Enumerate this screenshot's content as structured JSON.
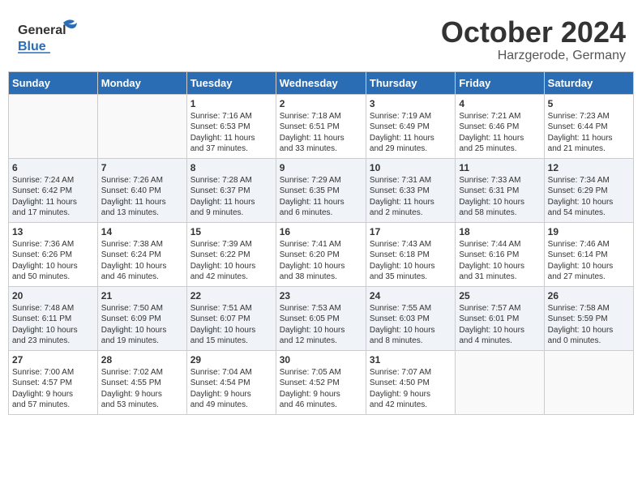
{
  "header": {
    "logo_general": "General",
    "logo_blue": "Blue",
    "month": "October 2024",
    "location": "Harzgerode, Germany"
  },
  "days_of_week": [
    "Sunday",
    "Monday",
    "Tuesday",
    "Wednesday",
    "Thursday",
    "Friday",
    "Saturday"
  ],
  "weeks": [
    [
      {
        "day": "",
        "info": ""
      },
      {
        "day": "",
        "info": ""
      },
      {
        "day": "1",
        "info": "Sunrise: 7:16 AM\nSunset: 6:53 PM\nDaylight: 11 hours\nand 37 minutes."
      },
      {
        "day": "2",
        "info": "Sunrise: 7:18 AM\nSunset: 6:51 PM\nDaylight: 11 hours\nand 33 minutes."
      },
      {
        "day": "3",
        "info": "Sunrise: 7:19 AM\nSunset: 6:49 PM\nDaylight: 11 hours\nand 29 minutes."
      },
      {
        "day": "4",
        "info": "Sunrise: 7:21 AM\nSunset: 6:46 PM\nDaylight: 11 hours\nand 25 minutes."
      },
      {
        "day": "5",
        "info": "Sunrise: 7:23 AM\nSunset: 6:44 PM\nDaylight: 11 hours\nand 21 minutes."
      }
    ],
    [
      {
        "day": "6",
        "info": "Sunrise: 7:24 AM\nSunset: 6:42 PM\nDaylight: 11 hours\nand 17 minutes."
      },
      {
        "day": "7",
        "info": "Sunrise: 7:26 AM\nSunset: 6:40 PM\nDaylight: 11 hours\nand 13 minutes."
      },
      {
        "day": "8",
        "info": "Sunrise: 7:28 AM\nSunset: 6:37 PM\nDaylight: 11 hours\nand 9 minutes."
      },
      {
        "day": "9",
        "info": "Sunrise: 7:29 AM\nSunset: 6:35 PM\nDaylight: 11 hours\nand 6 minutes."
      },
      {
        "day": "10",
        "info": "Sunrise: 7:31 AM\nSunset: 6:33 PM\nDaylight: 11 hours\nand 2 minutes."
      },
      {
        "day": "11",
        "info": "Sunrise: 7:33 AM\nSunset: 6:31 PM\nDaylight: 10 hours\nand 58 minutes."
      },
      {
        "day": "12",
        "info": "Sunrise: 7:34 AM\nSunset: 6:29 PM\nDaylight: 10 hours\nand 54 minutes."
      }
    ],
    [
      {
        "day": "13",
        "info": "Sunrise: 7:36 AM\nSunset: 6:26 PM\nDaylight: 10 hours\nand 50 minutes."
      },
      {
        "day": "14",
        "info": "Sunrise: 7:38 AM\nSunset: 6:24 PM\nDaylight: 10 hours\nand 46 minutes."
      },
      {
        "day": "15",
        "info": "Sunrise: 7:39 AM\nSunset: 6:22 PM\nDaylight: 10 hours\nand 42 minutes."
      },
      {
        "day": "16",
        "info": "Sunrise: 7:41 AM\nSunset: 6:20 PM\nDaylight: 10 hours\nand 38 minutes."
      },
      {
        "day": "17",
        "info": "Sunrise: 7:43 AM\nSunset: 6:18 PM\nDaylight: 10 hours\nand 35 minutes."
      },
      {
        "day": "18",
        "info": "Sunrise: 7:44 AM\nSunset: 6:16 PM\nDaylight: 10 hours\nand 31 minutes."
      },
      {
        "day": "19",
        "info": "Sunrise: 7:46 AM\nSunset: 6:14 PM\nDaylight: 10 hours\nand 27 minutes."
      }
    ],
    [
      {
        "day": "20",
        "info": "Sunrise: 7:48 AM\nSunset: 6:11 PM\nDaylight: 10 hours\nand 23 minutes."
      },
      {
        "day": "21",
        "info": "Sunrise: 7:50 AM\nSunset: 6:09 PM\nDaylight: 10 hours\nand 19 minutes."
      },
      {
        "day": "22",
        "info": "Sunrise: 7:51 AM\nSunset: 6:07 PM\nDaylight: 10 hours\nand 15 minutes."
      },
      {
        "day": "23",
        "info": "Sunrise: 7:53 AM\nSunset: 6:05 PM\nDaylight: 10 hours\nand 12 minutes."
      },
      {
        "day": "24",
        "info": "Sunrise: 7:55 AM\nSunset: 6:03 PM\nDaylight: 10 hours\nand 8 minutes."
      },
      {
        "day": "25",
        "info": "Sunrise: 7:57 AM\nSunset: 6:01 PM\nDaylight: 10 hours\nand 4 minutes."
      },
      {
        "day": "26",
        "info": "Sunrise: 7:58 AM\nSunset: 5:59 PM\nDaylight: 10 hours\nand 0 minutes."
      }
    ],
    [
      {
        "day": "27",
        "info": "Sunrise: 7:00 AM\nSunset: 4:57 PM\nDaylight: 9 hours\nand 57 minutes."
      },
      {
        "day": "28",
        "info": "Sunrise: 7:02 AM\nSunset: 4:55 PM\nDaylight: 9 hours\nand 53 minutes."
      },
      {
        "day": "29",
        "info": "Sunrise: 7:04 AM\nSunset: 4:54 PM\nDaylight: 9 hours\nand 49 minutes."
      },
      {
        "day": "30",
        "info": "Sunrise: 7:05 AM\nSunset: 4:52 PM\nDaylight: 9 hours\nand 46 minutes."
      },
      {
        "day": "31",
        "info": "Sunrise: 7:07 AM\nSunset: 4:50 PM\nDaylight: 9 hours\nand 42 minutes."
      },
      {
        "day": "",
        "info": ""
      },
      {
        "day": "",
        "info": ""
      }
    ]
  ]
}
